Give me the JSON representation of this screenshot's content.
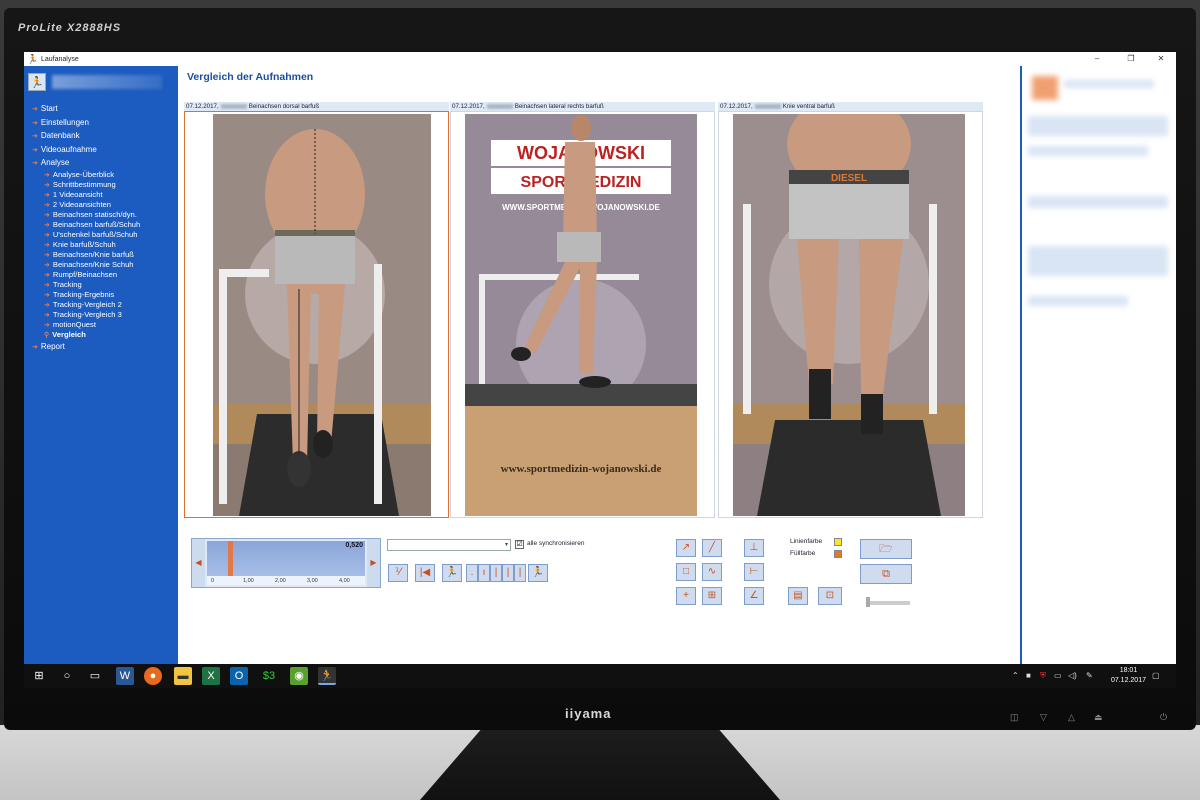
{
  "monitor": {
    "model": "ProLite X2888HS",
    "brand": "iiyama"
  },
  "window": {
    "title": "Laufanalyse",
    "controls": [
      "–",
      "❐",
      "✕"
    ]
  },
  "sidebar": {
    "items": [
      {
        "label": "Start",
        "level": 0
      },
      {
        "label": "Einstellungen",
        "level": 0
      },
      {
        "label": "Datenbank",
        "level": 0
      },
      {
        "label": "Videoaufnahme",
        "level": 0
      },
      {
        "label": "Analyse",
        "level": 0
      },
      {
        "label": "Analyse-Überblick",
        "level": 1
      },
      {
        "label": "Schrittbestimmung",
        "level": 1
      },
      {
        "label": "1 Videoansicht",
        "level": 1
      },
      {
        "label": "2 Videoansichten",
        "level": 1
      },
      {
        "label": "Beinachsen statisch/dyn.",
        "level": 1
      },
      {
        "label": "Beinachsen barfuß/Schuh",
        "level": 1
      },
      {
        "label": "U'schenkel barfuß/Schuh",
        "level": 1
      },
      {
        "label": "Knie barfuß/Schuh",
        "level": 1
      },
      {
        "label": "Beinachsen/Knie barfuß",
        "level": 1
      },
      {
        "label": "Beinachsen/Knie Schuh",
        "level": 1
      },
      {
        "label": "Rumpf/Beinachsen",
        "level": 1
      },
      {
        "label": "Tracking",
        "level": 1
      },
      {
        "label": "Tracking-Ergebnis",
        "level": 1
      },
      {
        "label": "Tracking-Vergleich 2",
        "level": 1
      },
      {
        "label": "Tracking-Vergleich 3",
        "level": 1
      },
      {
        "label": "motionQuest",
        "level": 1
      },
      {
        "label": "Vergleich",
        "level": 1,
        "active": true
      },
      {
        "label": "Report",
        "level": 0
      }
    ]
  },
  "main": {
    "title": "Vergleich der Aufnahmen",
    "panels": [
      {
        "date": "07.12.2017,",
        "label": "Beinachsen dorsal barfuß"
      },
      {
        "date": "07.12.2017,",
        "label": "Beinachsen lateral rechts barfuß"
      },
      {
        "date": "07.12.2017,",
        "label": "Knie ventral barfuß"
      }
    ],
    "photo_text": {
      "banner_line1": "WOJANOWSKI",
      "banner_line2": "SPORTMEDIZIN",
      "banner_url": "WWW.SPORTMEDIZIN-WOJANOWSKI.DE",
      "platform_url": "www.sportmedizin-wojanowski.de",
      "waistband": "DIESEL"
    },
    "slider": {
      "value": "0,520",
      "ticks": [
        "0",
        "1,00",
        "2,00",
        "3,00",
        "4,00"
      ],
      "position": 0.13
    },
    "sync": {
      "label": "alle synchronisieren",
      "checked": "☑"
    },
    "legend": {
      "line_label": "Linienfarbe",
      "fill_label": "Füllfarbe",
      "line_color": "#f5e62a",
      "fill_color": "#e07830"
    }
  },
  "taskbar": {
    "time": "18:01",
    "date": "07.12.2017"
  }
}
